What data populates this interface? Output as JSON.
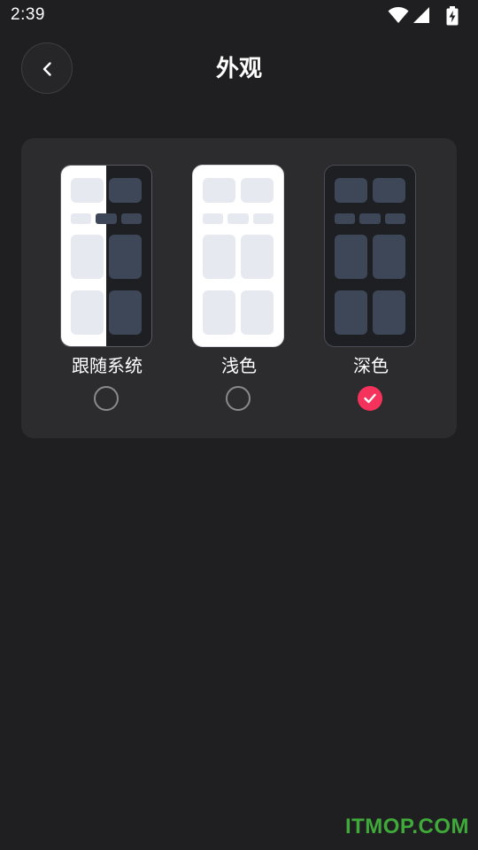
{
  "status_bar": {
    "time": "2:39",
    "icons": [
      "wifi-icon",
      "cellular-signal-icon",
      "battery-charging-icon"
    ]
  },
  "header": {
    "back_icon": "chevron-left-icon",
    "title": "外观"
  },
  "theme_options": [
    {
      "label": "跟随系统",
      "preview": "split-light-dark",
      "selected": false
    },
    {
      "label": "浅色",
      "preview": "light",
      "selected": false
    },
    {
      "label": "深色",
      "preview": "dark",
      "selected": true
    }
  ],
  "colors": {
    "background": "#1f1f21",
    "card": "#2c2c2e",
    "accent": "#f5325c",
    "watermark": "#3faa3a"
  },
  "watermark": "ITMOP.COM"
}
